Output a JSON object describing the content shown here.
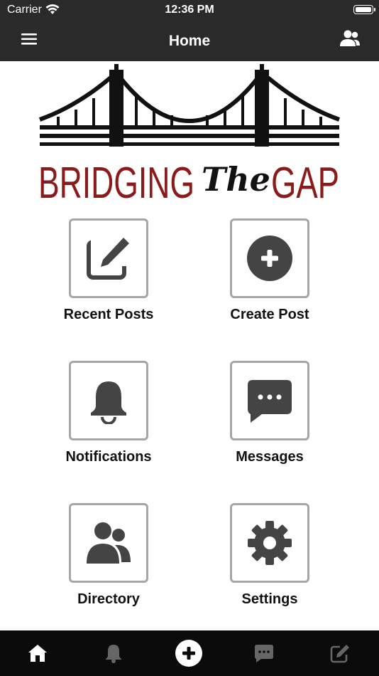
{
  "status_bar": {
    "carrier": "Carrier",
    "time": "12:36 PM"
  },
  "nav": {
    "title": "Home",
    "left_icon": "hamburger-menu-icon",
    "right_icon": "users-icon"
  },
  "logo": {
    "top_text": "BRIDGING",
    "script_text": "The",
    "end_text": "GAP",
    "brand_red": "#8b1a1a"
  },
  "tiles": [
    {
      "label": "Recent Posts",
      "icon": "edit-icon"
    },
    {
      "label": "Create Post",
      "icon": "plus-circle-icon"
    },
    {
      "label": "Notifications",
      "icon": "bell-icon"
    },
    {
      "label": "Messages",
      "icon": "message-icon"
    },
    {
      "label": "Directory",
      "icon": "users-icon"
    },
    {
      "label": "Settings",
      "icon": "gear-icon"
    }
  ],
  "tab_bar": {
    "icons": [
      "home-icon",
      "bell-icon",
      "plus-circle-icon",
      "message-icon",
      "edit-icon"
    ]
  },
  "colors": {
    "bar_dark": "#2a2a2a",
    "tab_bar": "#0b0b0b",
    "icon_dark": "#444444",
    "tile_border": "#a6a6a6"
  }
}
